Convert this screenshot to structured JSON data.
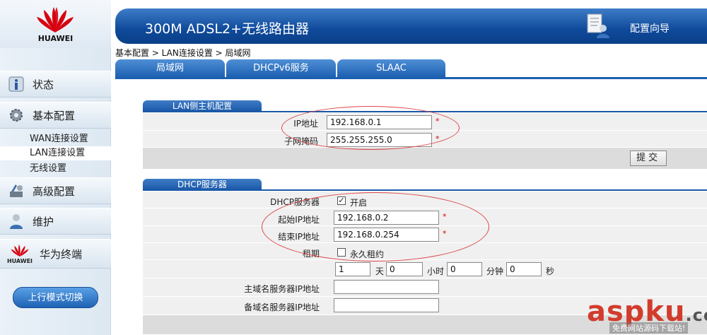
{
  "brand": "HUAWEI",
  "header": {
    "title": "300M ADSL2+无线路由器",
    "wizard_label": "配置向导"
  },
  "breadcrumb": "基本配置 > LAN连接设置 > 局域网",
  "tabs": [
    {
      "label": "局域网"
    },
    {
      "label": "DHCPv6服务"
    },
    {
      "label": "SLAAC"
    }
  ],
  "sidebar": {
    "items": [
      {
        "label": "状态"
      },
      {
        "label": "基本配置"
      },
      {
        "label": "WAN连接设置"
      },
      {
        "label": "LAN连接设置"
      },
      {
        "label": "无线设置"
      },
      {
        "label": "高级配置"
      },
      {
        "label": "维护"
      },
      {
        "label": "华为终端"
      }
    ],
    "mode_button": "上行模式切换"
  },
  "lan": {
    "section_title": "LAN侧主机配置",
    "ip_label": "IP地址",
    "ip_value": "192.168.0.1",
    "mask_label": "子网掩码",
    "mask_value": "255.255.255.0",
    "submit_label": "提交"
  },
  "dhcp": {
    "section_title": "DHCP服务器",
    "server_label": "DHCP服务器",
    "server_enabled_label": "开启",
    "start_label": "起始IP地址",
    "start_value": "192.168.0.2",
    "end_label": "结束IP地址",
    "end_value": "192.168.0.254",
    "lease_label": "租期",
    "permanent_label": "永久租约",
    "lease_days": "1",
    "days_unit": "天",
    "lease_hours": "0",
    "hours_unit": "小时",
    "lease_minutes": "0",
    "minutes_unit": "分钟",
    "lease_seconds": "0",
    "seconds_unit": "秒",
    "dns1_label": "主域名服务器IP地址",
    "dns2_label": "备域名服务器IP地址"
  },
  "watermark": {
    "text": "aspku",
    "suffix": ".com",
    "sub": "免费网站源码下载站!"
  },
  "colors": {
    "accent": "#1b5fb0",
    "required": "#dd0000",
    "highlight_ellipse": "#dd4444",
    "watermark": "#d23c2c"
  }
}
